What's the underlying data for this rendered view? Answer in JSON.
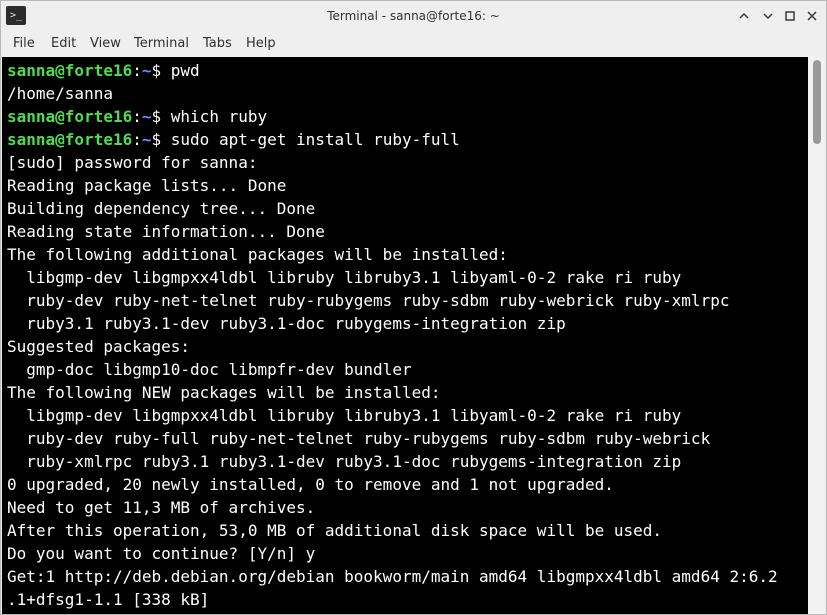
{
  "window": {
    "title": "Terminal - sanna@forte16: ~",
    "app_icon_glyph": ">_",
    "buttons": [
      "chevron-up-icon",
      "minimize-icon",
      "maximize-icon",
      "close-icon"
    ]
  },
  "menubar": {
    "items": [
      "File",
      "Edit",
      "View",
      "Terminal",
      "Tabs",
      "Help"
    ]
  },
  "terminal": {
    "colors": {
      "background": "#000000",
      "text": "#ffffff",
      "prompt_user": "#4fdc4f",
      "prompt_path": "#6a8cff"
    },
    "prompt": {
      "user_host": "sanna@forte16",
      "separator": ":",
      "path": "~",
      "symbol": "$ "
    },
    "lines": [
      {
        "type": "prompt",
        "command": "pwd"
      },
      {
        "type": "output",
        "text": "/home/sanna"
      },
      {
        "type": "prompt",
        "command": "which ruby"
      },
      {
        "type": "prompt",
        "command": "sudo apt-get install ruby-full"
      },
      {
        "type": "output",
        "text": "[sudo] password for sanna:"
      },
      {
        "type": "output",
        "text": "Reading package lists... Done"
      },
      {
        "type": "output",
        "text": "Building dependency tree... Done"
      },
      {
        "type": "output",
        "text": "Reading state information... Done"
      },
      {
        "type": "output",
        "text": "The following additional packages will be installed:"
      },
      {
        "type": "output",
        "text": "  libgmp-dev libgmpxx4ldbl libruby libruby3.1 libyaml-0-2 rake ri ruby"
      },
      {
        "type": "output",
        "text": "  ruby-dev ruby-net-telnet ruby-rubygems ruby-sdbm ruby-webrick ruby-xmlrpc"
      },
      {
        "type": "output",
        "text": "  ruby3.1 ruby3.1-dev ruby3.1-doc rubygems-integration zip"
      },
      {
        "type": "output",
        "text": "Suggested packages:"
      },
      {
        "type": "output",
        "text": "  gmp-doc libgmp10-doc libmpfr-dev bundler"
      },
      {
        "type": "output",
        "text": "The following NEW packages will be installed:"
      },
      {
        "type": "output",
        "text": "  libgmp-dev libgmpxx4ldbl libruby libruby3.1 libyaml-0-2 rake ri ruby"
      },
      {
        "type": "output",
        "text": "  ruby-dev ruby-full ruby-net-telnet ruby-rubygems ruby-sdbm ruby-webrick"
      },
      {
        "type": "output",
        "text": "  ruby-xmlrpc ruby3.1 ruby3.1-dev ruby3.1-doc rubygems-integration zip"
      },
      {
        "type": "output",
        "text": "0 upgraded, 20 newly installed, 0 to remove and 1 not upgraded."
      },
      {
        "type": "output",
        "text": "Need to get 11,3 MB of archives."
      },
      {
        "type": "output",
        "text": "After this operation, 53,0 MB of additional disk space will be used."
      },
      {
        "type": "output",
        "text": "Do you want to continue? [Y/n] y"
      },
      {
        "type": "output",
        "text": "Get:1 http://deb.debian.org/debian bookworm/main amd64 libgmpxx4ldbl amd64 2:6.2"
      },
      {
        "type": "output",
        "text": ".1+dfsg1-1.1 [338 kB]"
      }
    ]
  }
}
